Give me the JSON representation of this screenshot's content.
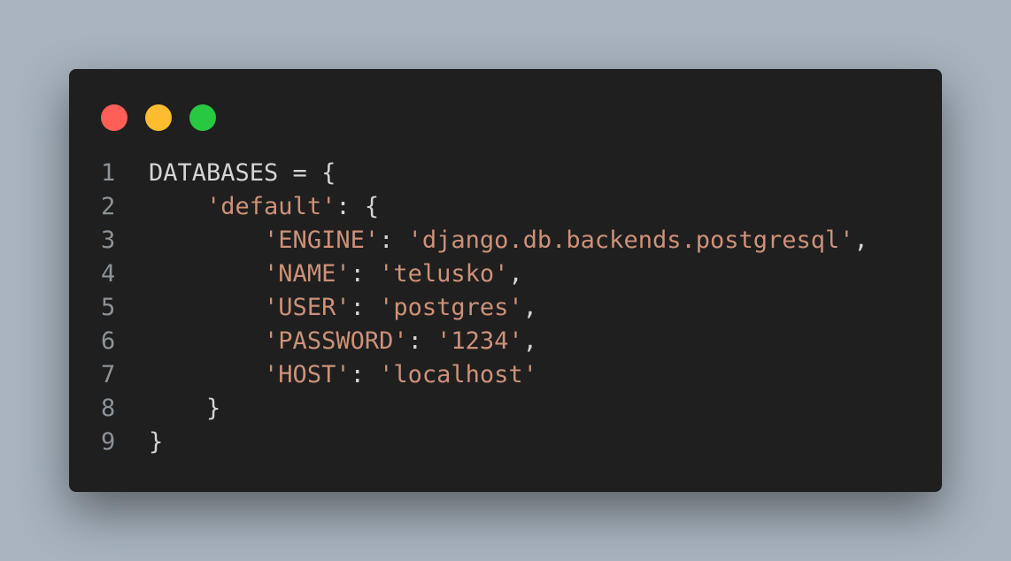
{
  "window": {
    "controls": {
      "close_color": "#ff5f57",
      "minimize_color": "#febc2e",
      "maximize_color": "#28c840"
    }
  },
  "colors": {
    "background": "#a8b3bd",
    "editor_background": "#1f1f1f",
    "text": "#d4d4d4",
    "string": "#ce9178",
    "line_number": "#8c9399"
  },
  "code": {
    "lines": [
      {
        "number": "1",
        "indent": "",
        "tokens": [
          {
            "type": "pn",
            "text": "DATABASES = {"
          }
        ]
      },
      {
        "number": "2",
        "indent": "    ",
        "tokens": [
          {
            "type": "str",
            "text": "'default'"
          },
          {
            "type": "pn",
            "text": ": {"
          }
        ]
      },
      {
        "number": "3",
        "indent": "        ",
        "tokens": [
          {
            "type": "str",
            "text": "'ENGINE'"
          },
          {
            "type": "pn",
            "text": ": "
          },
          {
            "type": "str",
            "text": "'django.db.backends.postgresql'"
          },
          {
            "type": "pn",
            "text": ","
          }
        ]
      },
      {
        "number": "4",
        "indent": "        ",
        "tokens": [
          {
            "type": "str",
            "text": "'NAME'"
          },
          {
            "type": "pn",
            "text": ": "
          },
          {
            "type": "str",
            "text": "'telusko'"
          },
          {
            "type": "pn",
            "text": ","
          }
        ]
      },
      {
        "number": "5",
        "indent": "        ",
        "tokens": [
          {
            "type": "str",
            "text": "'USER'"
          },
          {
            "type": "pn",
            "text": ": "
          },
          {
            "type": "str",
            "text": "'postgres'"
          },
          {
            "type": "pn",
            "text": ","
          }
        ]
      },
      {
        "number": "6",
        "indent": "        ",
        "tokens": [
          {
            "type": "str",
            "text": "'PASSWORD'"
          },
          {
            "type": "pn",
            "text": ": "
          },
          {
            "type": "str",
            "text": "'1234'"
          },
          {
            "type": "pn",
            "text": ","
          }
        ]
      },
      {
        "number": "7",
        "indent": "        ",
        "tokens": [
          {
            "type": "str",
            "text": "'HOST'"
          },
          {
            "type": "pn",
            "text": ": "
          },
          {
            "type": "str",
            "text": "'localhost'"
          }
        ]
      },
      {
        "number": "8",
        "indent": "    ",
        "tokens": [
          {
            "type": "pn",
            "text": "}"
          }
        ]
      },
      {
        "number": "9",
        "indent": "",
        "tokens": [
          {
            "type": "pn",
            "text": "}"
          }
        ]
      }
    ]
  }
}
